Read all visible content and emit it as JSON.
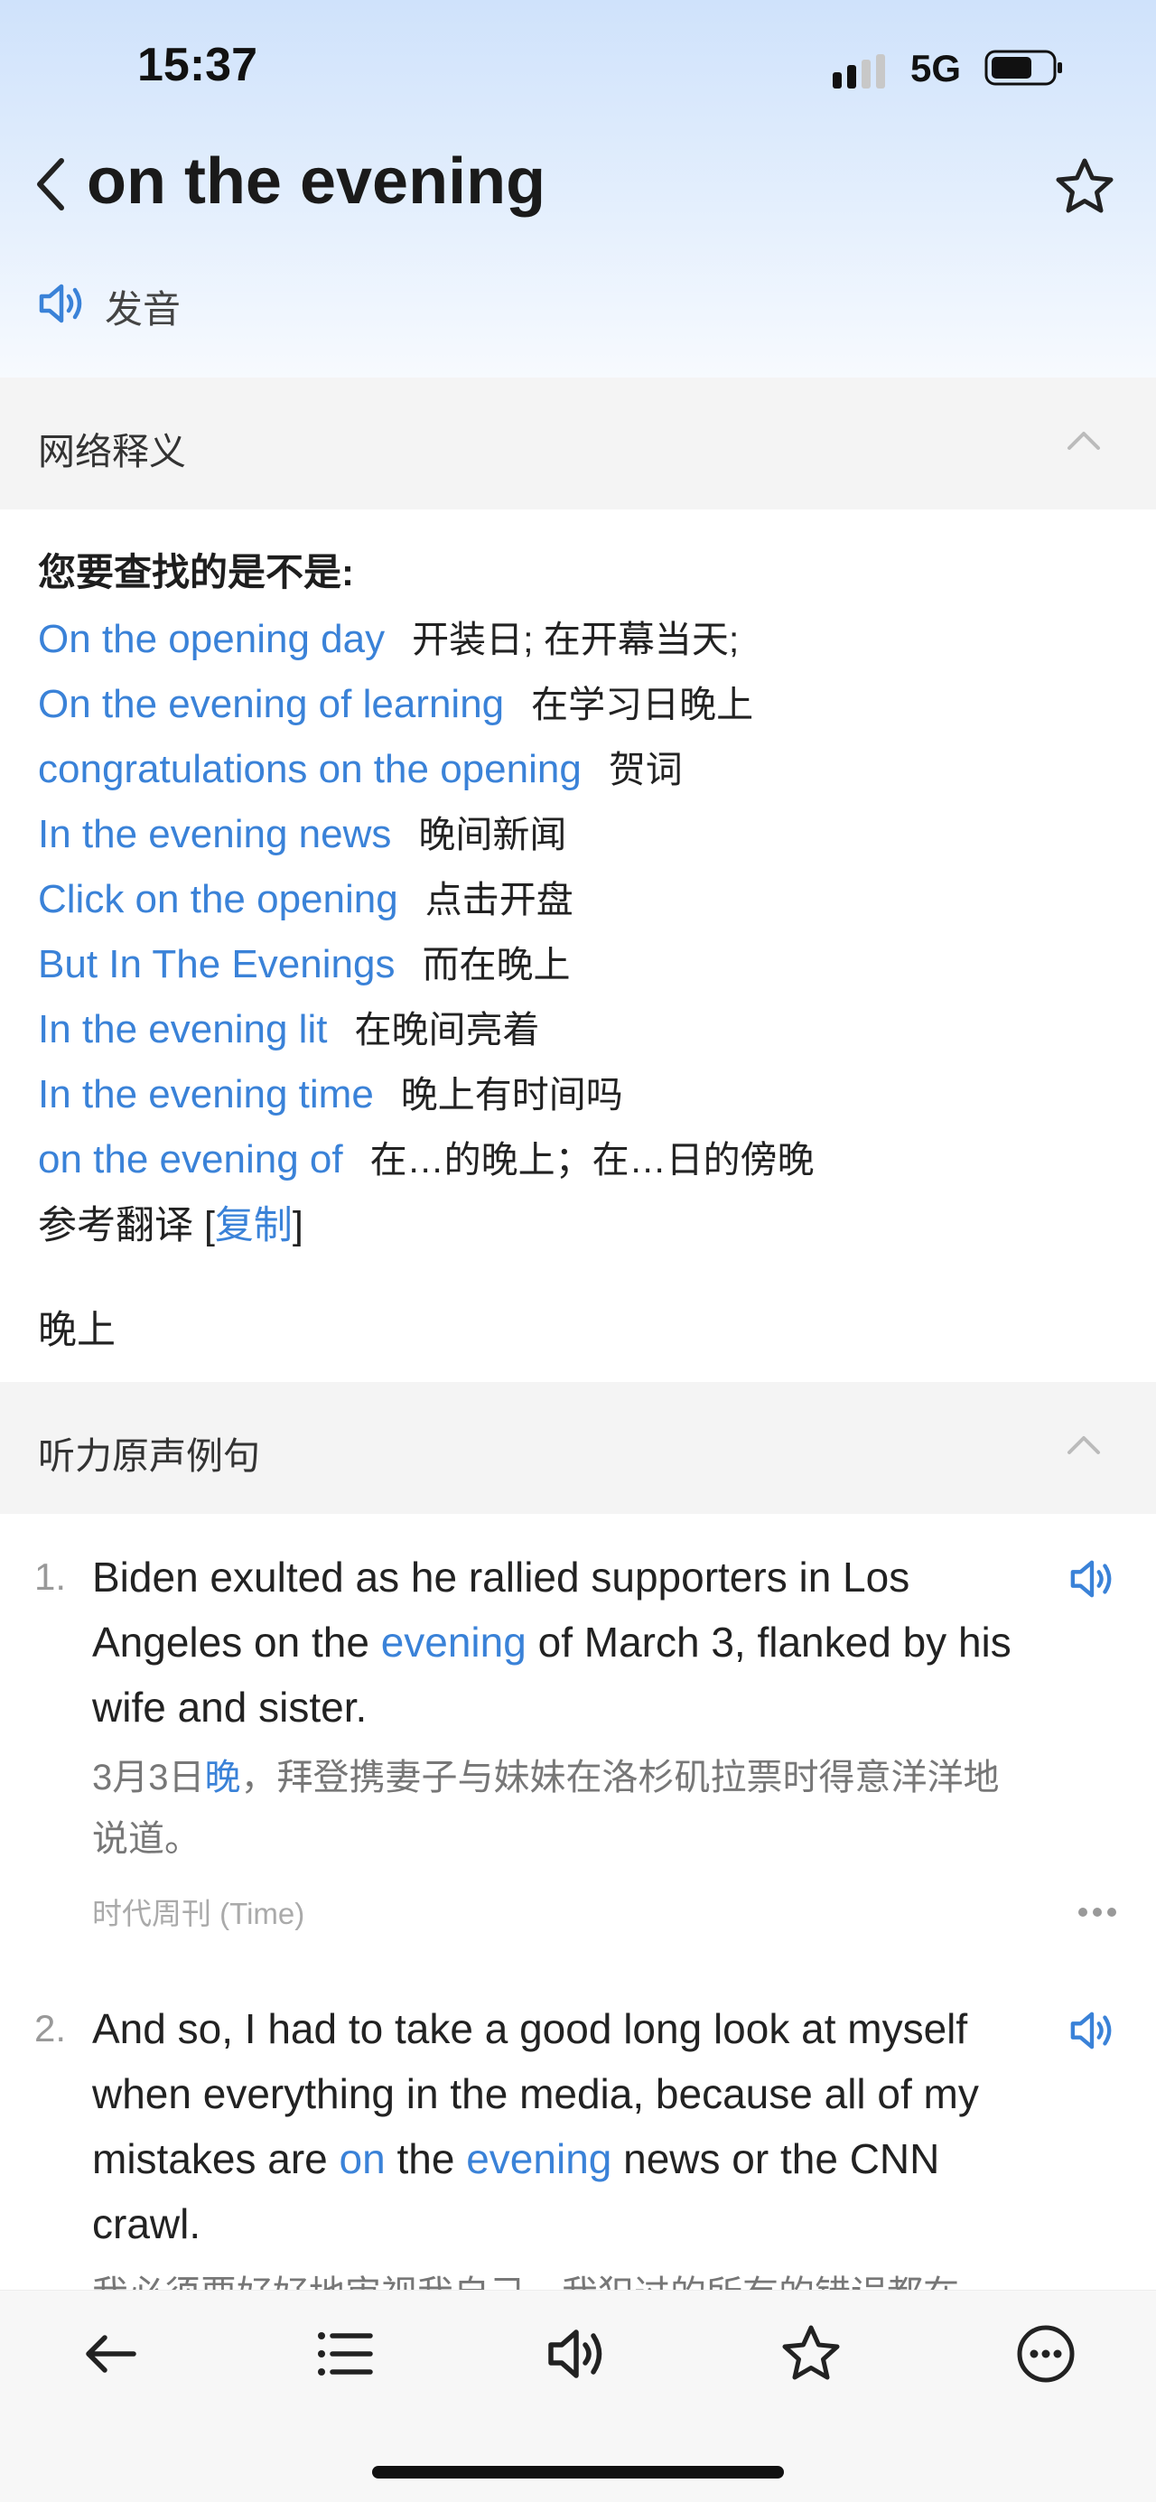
{
  "status": {
    "time": "15:37",
    "network": "5G"
  },
  "header": {
    "title": "on the evening",
    "pronounce_label": "发音"
  },
  "web_section": {
    "title": "网络释义",
    "query_title": "您要查找的是不是:",
    "suggestions": [
      {
        "en": "On the opening day",
        "zh": "开装日; 在开幕当天;"
      },
      {
        "en": "On the evening of learning",
        "zh": "在学习日晚上"
      },
      {
        "en": "congratulations on the opening",
        "zh": "贺词"
      },
      {
        "en": "In the evening news",
        "zh": "晚间新闻"
      },
      {
        "en": "Click on the opening",
        "zh": "点击开盘"
      },
      {
        "en": "But In The Evenings",
        "zh": "而在晚上"
      },
      {
        "en": "In the evening lit",
        "zh": "在晚间亮着"
      },
      {
        "en": "In the evening time",
        "zh": "晚上有时间吗"
      },
      {
        "en": "on the evening of",
        "zh": "在…的晚上；在…日的傍晚"
      }
    ],
    "reference_label": "参考翻译",
    "copy_label": "复制",
    "reference_translation": "晚上"
  },
  "listening_section": {
    "title": "听力原声例句",
    "examples": [
      {
        "num": "1.",
        "en_before": "Biden exulted as he rallied supporters in Los Angeles on the ",
        "en_hl1": "evening",
        "en_after": " of March 3, flanked by his wife and sister.",
        "zh_before": "3月3日",
        "zh_hl": "晚",
        "zh_after": "，拜登携妻子与妹妹在洛杉矶拉票时得意洋洋地说道。",
        "source": "时代周刊 (Time)"
      },
      {
        "num": "2.",
        "en_before": "And so, I had to take a good long look at myself when everything in the media, because all of my mistakes are ",
        "en_hl1": "on",
        "en_mid": " the ",
        "en_hl2": "evening",
        "en_after": " news or the CNN crawl.",
        "zh_partial": "我必须要好好地审视我自己，我犯过的所有的错误都在"
      }
    ]
  },
  "bottom_bar": [
    "back-arrow-icon",
    "list-icon",
    "speaker-icon",
    "star-icon",
    "more-circle-icon"
  ],
  "colors": {
    "accent": "#3a82d8",
    "header_gradient_top": "#cfe2fb",
    "section_bg": "#f4f4f4"
  }
}
